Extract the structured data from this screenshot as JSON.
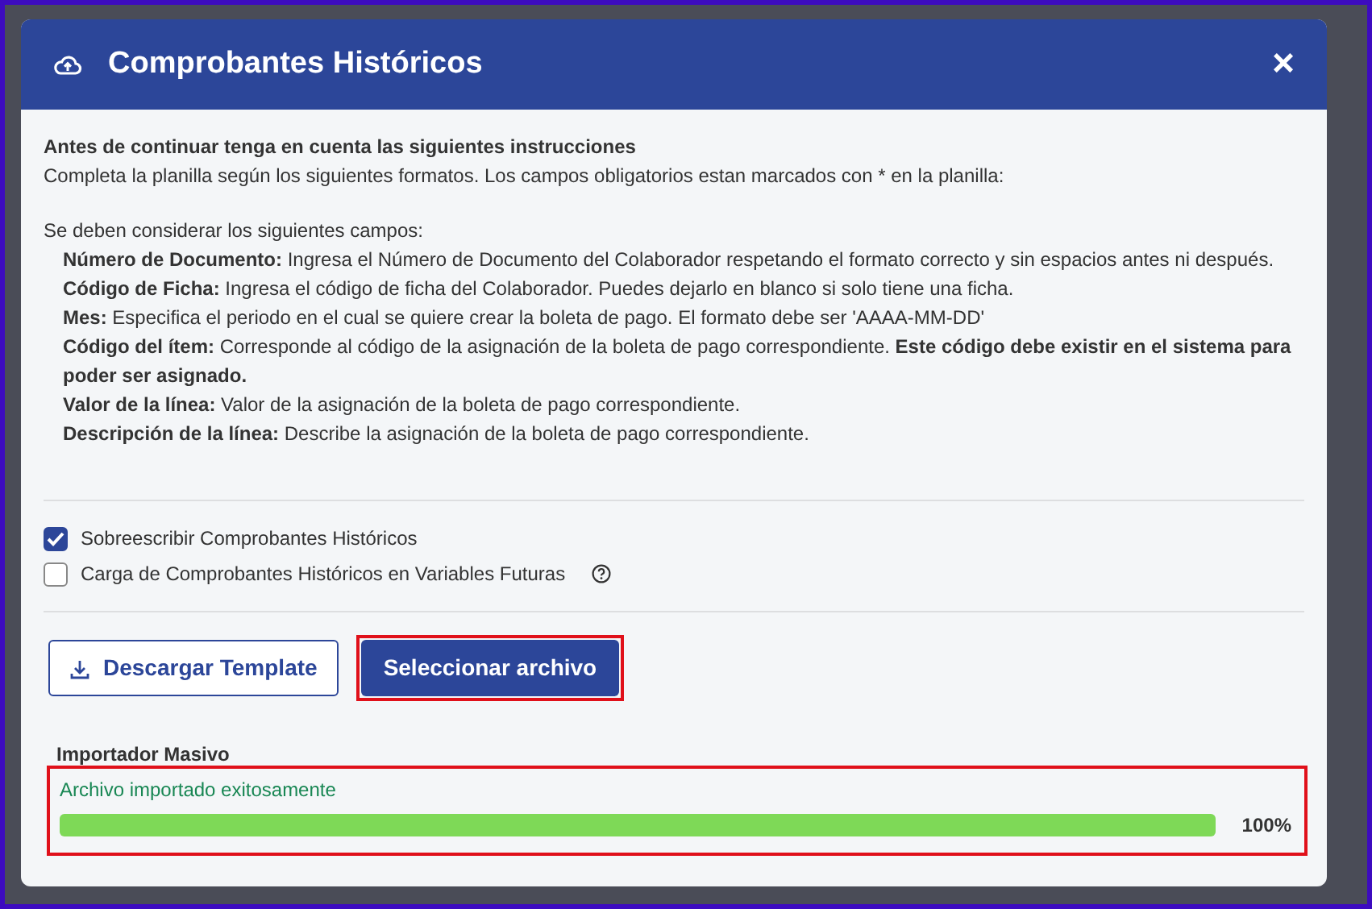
{
  "modal": {
    "title": "Comprobantes Históricos",
    "close": "×"
  },
  "instructions": {
    "heading": "Antes de continuar tenga en cuenta las siguientes instrucciones",
    "intro": "Completa la planilla según los siguientes formatos. Los campos obligatorios estan marcados con * en la planilla:",
    "fields_intro": "Se deben considerar los siguientes campos:",
    "fields": [
      {
        "label": "Número de Documento:",
        "text": "Ingresa el Número de Documento del Colaborador respetando el formato correcto y sin espacios antes ni después."
      },
      {
        "label": "Código de Ficha:",
        "text": "Ingresa el código de ficha del Colaborador. Puedes dejarlo en blanco si solo tiene una ficha."
      },
      {
        "label": "Mes:",
        "text": "Especifica el periodo en el cual se quiere crear la boleta de pago. El formato debe ser 'AAAA-MM-DD'"
      },
      {
        "label": "Código del ítem:",
        "text": "Corresponde al código de la asignación de la boleta de pago correspondiente. **Este código debe existir en el sistema para poder ser asignado.**"
      },
      {
        "label": "Valor de la línea:",
        "text": "Valor de la asignación de la boleta de pago correspondiente."
      },
      {
        "label": "Descripción de la línea:",
        "text": "Describe la asignación de la boleta de pago correspondiente."
      }
    ]
  },
  "options": [
    {
      "label": "Sobreescribir Comprobantes Históricos",
      "checked": true,
      "help": false
    },
    {
      "label": "Carga de Comprobantes Históricos en Variables Futuras",
      "checked": false,
      "help": true
    }
  ],
  "buttons": [
    {
      "label": "Descargar Template",
      "kind": "outline",
      "highlighted": false
    },
    {
      "label": "Seleccionar archivo",
      "kind": "primary",
      "highlighted": true
    }
  ],
  "importer": {
    "title": "Importador Masivo",
    "message": "Archivo importado exitosamente",
    "level": 1,
    "reading": "100%",
    "highlighted": true
  }
}
